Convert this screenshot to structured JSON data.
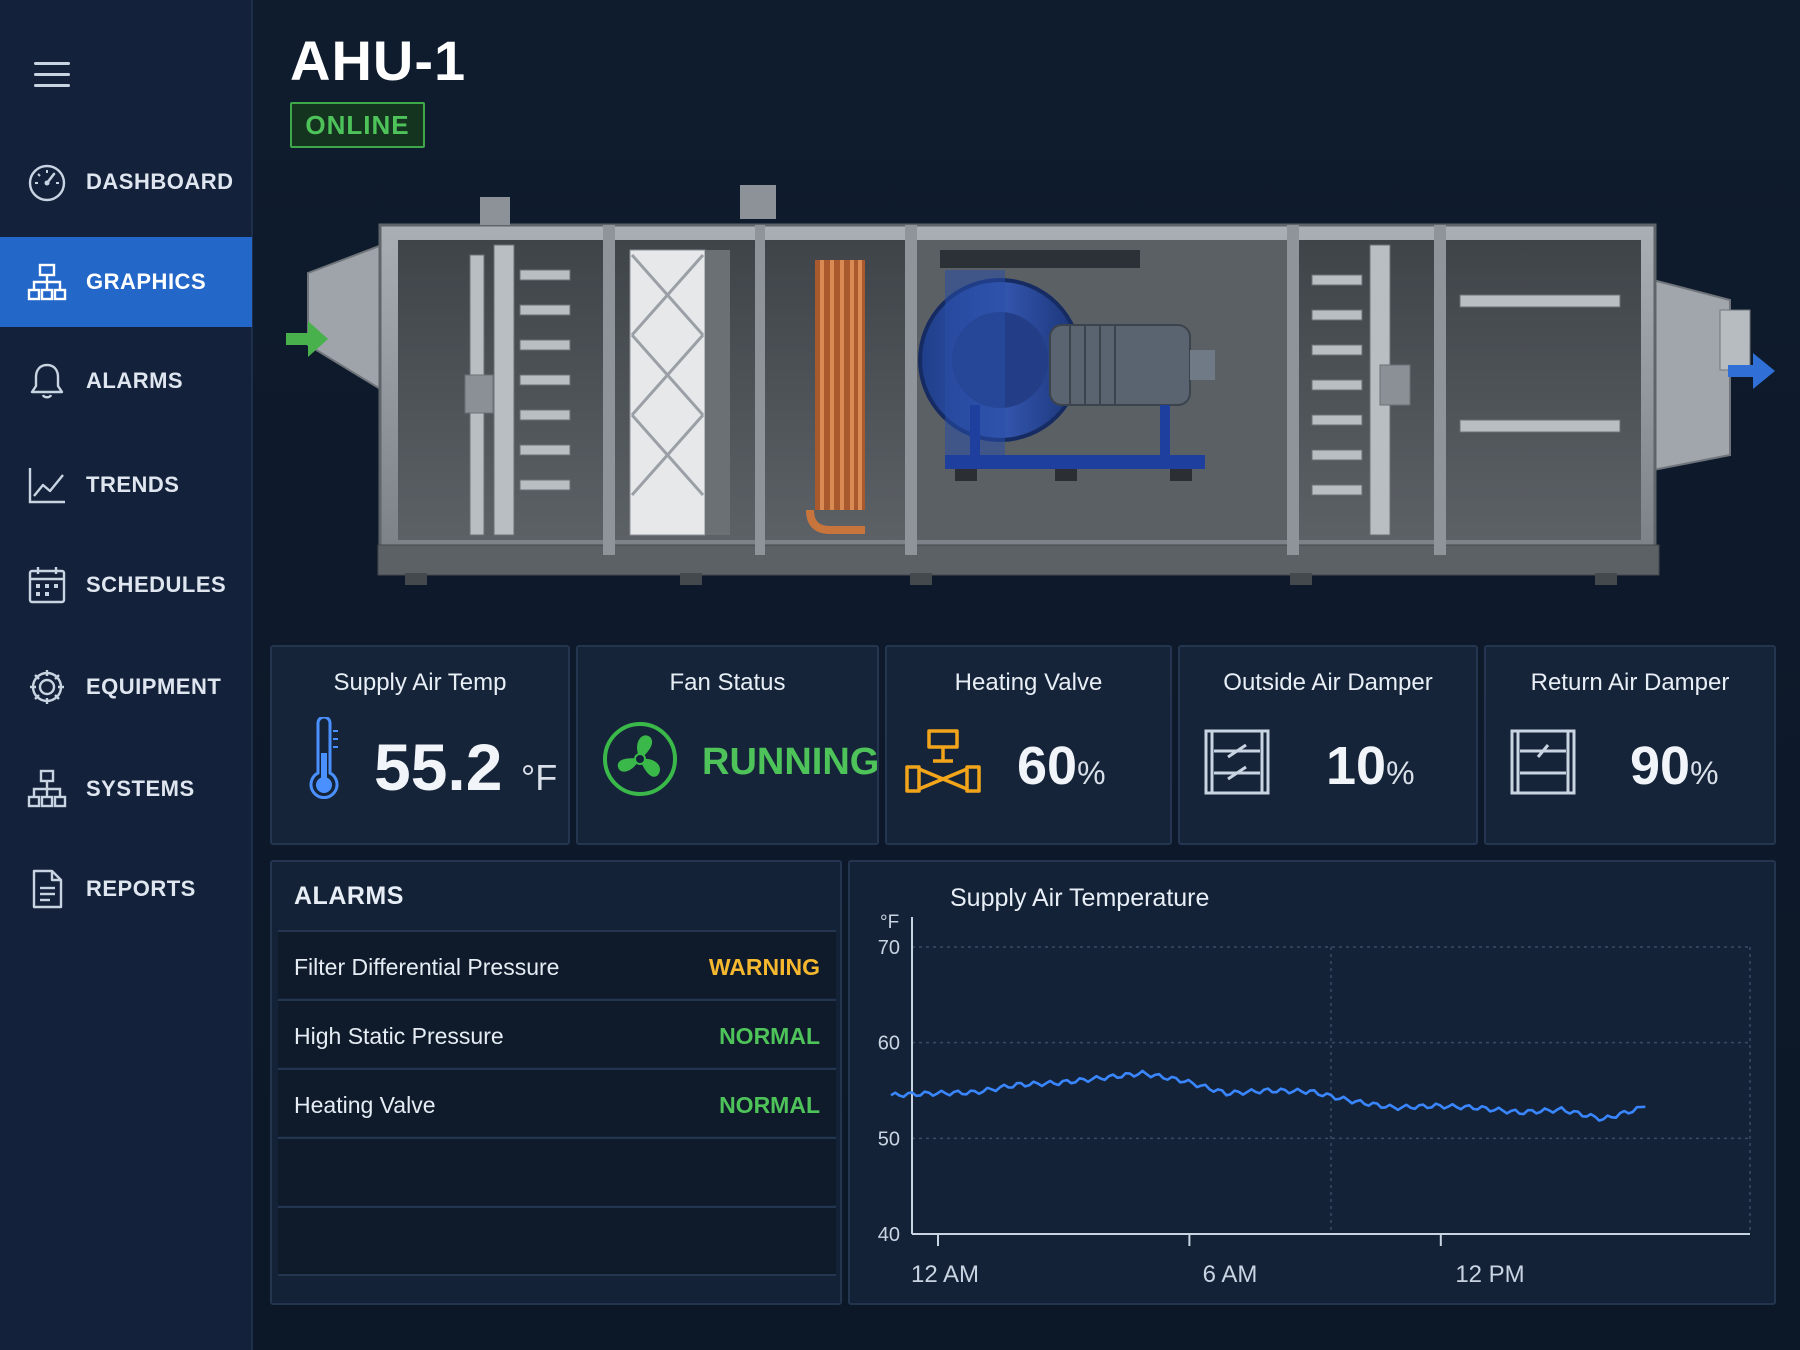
{
  "sidebar": {
    "items": [
      {
        "label": "DASHBOARD",
        "icon": "gauge-icon",
        "active": false
      },
      {
        "label": "GRAPHICS",
        "icon": "hierarchy-icon",
        "active": true
      },
      {
        "label": "ALARMS",
        "icon": "bell-icon",
        "active": false
      },
      {
        "label": "TRENDS",
        "icon": "line-chart-icon",
        "active": false
      },
      {
        "label": "SCHEDULES",
        "icon": "calendar-icon",
        "active": false
      },
      {
        "label": "EQUIPMENT",
        "icon": "gear-icon",
        "active": false
      },
      {
        "label": "SYSTEMS",
        "icon": "network-icon",
        "active": false
      },
      {
        "label": "REPORTS",
        "icon": "document-icon",
        "active": false
      }
    ]
  },
  "header": {
    "title": "AHU-1",
    "status": "ONLINE"
  },
  "metrics": {
    "supply_air_temp": {
      "title": "Supply Air Temp",
      "value": "55.2",
      "unit": "°F"
    },
    "fan_status": {
      "title": "Fan Status",
      "value": "RUNNING"
    },
    "heating_valve": {
      "title": "Heating Valve",
      "value": "60",
      "unit": "%"
    },
    "outside_air_damper": {
      "title": "Outside Air Damper",
      "value": "10",
      "unit": "%"
    },
    "return_air_damper": {
      "title": "Return Air Damper",
      "value": "90",
      "unit": "%"
    }
  },
  "alarms": {
    "title": "ALARMS",
    "rows": [
      {
        "name": "Filter Differential Pressure",
        "state": "WARNING"
      },
      {
        "name": "High Static Pressure",
        "state": "NORMAL"
      },
      {
        "name": "Heating Valve",
        "state": "NORMAL"
      },
      {
        "name": "",
        "state": ""
      },
      {
        "name": "",
        "state": ""
      }
    ]
  },
  "colors": {
    "accent": "#2367c9",
    "online": "#4ec35a",
    "warning": "#f5b82e",
    "normal": "#4ec35a",
    "series": "#3a86ff",
    "heating": "#f2a51a"
  },
  "chart_data": {
    "type": "line",
    "title": "Supply Air Temperature",
    "ylabel": "°F",
    "xlabel": "",
    "ylim": [
      40,
      70
    ],
    "yticks": [
      40,
      50,
      60,
      70
    ],
    "xlim": [
      0,
      20
    ],
    "xticks": [
      {
        "x": 0,
        "label": "12 AM"
      },
      {
        "x": 6,
        "label": "6 AM"
      },
      {
        "x": 12,
        "label": "12 PM"
      }
    ],
    "grid": true,
    "series": [
      {
        "x": [
          -0.5,
          0.5,
          1.5,
          2.5,
          3.5,
          4.5,
          5.5,
          6.5,
          7.5,
          8.5,
          9.5,
          10.5,
          11.5,
          12.5,
          13.5,
          14.5,
          15.5,
          16.5,
          17.5
        ],
        "values": [
          54.5,
          54.7,
          54.8,
          55.6,
          55.8,
          56.3,
          56.8,
          56.0,
          54.7,
          55.0,
          54.9,
          53.9,
          53.2,
          53.4,
          53.2,
          52.7,
          53.0,
          52.0,
          53.3
        ]
      }
    ]
  }
}
